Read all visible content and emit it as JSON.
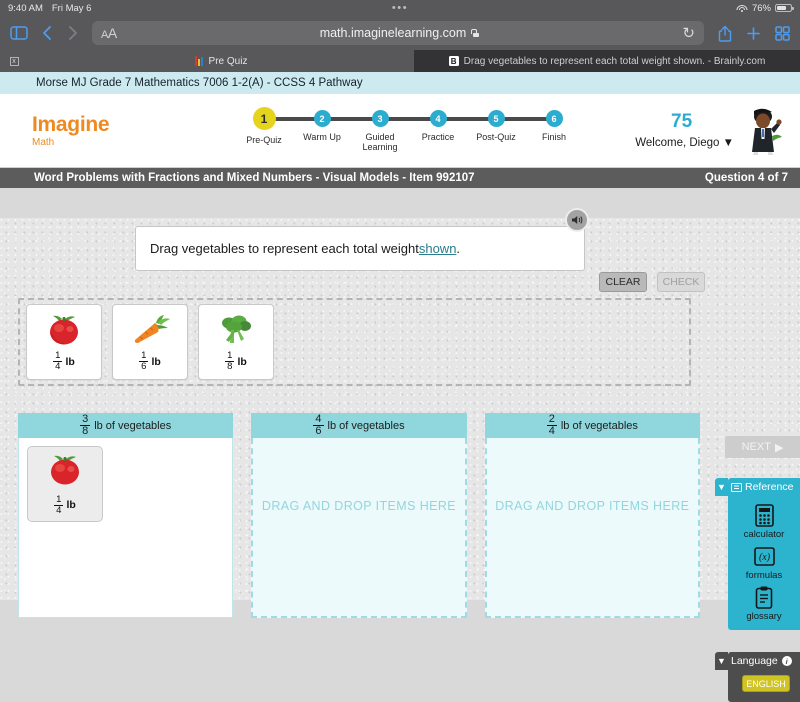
{
  "status_bar": {
    "time": "9:40 AM",
    "date": "Fri May 6",
    "dots": "•••",
    "battery_pct": "76%"
  },
  "browser": {
    "url": "math.imaginelearning.com",
    "aa_label": "A",
    "aa_label_big": "A",
    "reload_glyph": "↻",
    "tabs": [
      {
        "title": "Pre Quiz",
        "favicon": "bars-favicon",
        "active": true
      },
      {
        "title": "Drag vegetables to represent each total weight shown. - Brainly.com",
        "favicon": "brainly-favicon",
        "active": false
      }
    ],
    "close_glyph": "x"
  },
  "class_bar": {
    "text": "Morse MJ Grade 7 Mathematics 7006 1-2(A) - CCSS 4 Pathway"
  },
  "app_header": {
    "logo_line1": "Imagine",
    "logo_line2": "Math",
    "steps": [
      {
        "num": "1",
        "label": "Pre-Quiz",
        "current": true
      },
      {
        "num": "2",
        "label": "Warm Up",
        "current": false
      },
      {
        "num": "3",
        "label": "Guided Learning",
        "current": false
      },
      {
        "num": "4",
        "label": "Practice",
        "current": false
      },
      {
        "num": "5",
        "label": "Post-Quiz",
        "current": false
      },
      {
        "num": "6",
        "label": "Finish",
        "current": false
      }
    ],
    "score": "75",
    "welcome": "Welcome, Diego",
    "welcome_caret": "▼"
  },
  "title_bar": {
    "lesson": "Word Problems with Fractions and Mixed Numbers - Visual Models - Item 992107",
    "question": "Question 4 of 7"
  },
  "question": {
    "prompt_before": "Drag vegetables to represent each total weight ",
    "prompt_link": "shown",
    "prompt_after": ".",
    "speaker_glyph": "🔊"
  },
  "buttons": {
    "clear": "CLEAR",
    "check": "CHECK",
    "next": "NEXT",
    "next_glyph": "▶"
  },
  "tray": {
    "items": [
      {
        "name": "tomato",
        "num": "1",
        "den": "4",
        "unit": "lb"
      },
      {
        "name": "carrot",
        "num": "1",
        "den": "6",
        "unit": "lb"
      },
      {
        "name": "broccoli",
        "num": "1",
        "den": "8",
        "unit": "lb"
      }
    ]
  },
  "drop_zones": [
    {
      "num": "3",
      "den": "8",
      "label": "lb of vegetables",
      "empty": false,
      "placeholder": "",
      "placed": [
        {
          "name": "tomato",
          "num": "1",
          "den": "4",
          "unit": "lb"
        }
      ]
    },
    {
      "num": "4",
      "den": "6",
      "label": "lb of vegetables",
      "empty": true,
      "placeholder": "DRAG AND DROP ITEMS HERE",
      "placed": []
    },
    {
      "num": "2",
      "den": "4",
      "label": "lb of vegetables",
      "empty": true,
      "placeholder": "DRAG AND DROP ITEMS HERE",
      "placed": []
    }
  ],
  "reference_panel": {
    "title": "Reference",
    "caret": "▼",
    "items": [
      {
        "label": "calculator",
        "icon": "calculator-icon"
      },
      {
        "label": "formulas",
        "icon": "formulas-icon",
        "glyph": "(x)"
      },
      {
        "label": "glossary",
        "icon": "glossary-icon"
      }
    ]
  },
  "language_panel": {
    "title": "Language",
    "caret": "▼",
    "info_glyph": "i",
    "current": "ENGLISH"
  },
  "colors": {
    "brand_orange": "#ef8a21",
    "teal": "#2cb4cf",
    "yellow_step": "#e5d31c",
    "zone_header": "#8fd6dd",
    "chrome_gray": "#58585a"
  }
}
